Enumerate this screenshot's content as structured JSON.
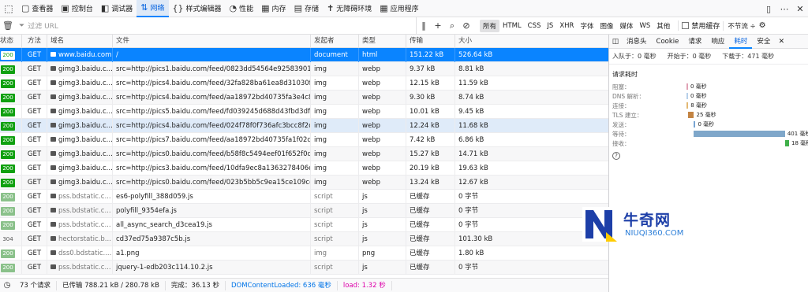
{
  "toolbar": {
    "tabs": [
      {
        "label": "查看器",
        "icon": "inspector-icon",
        "glyph": "▢"
      },
      {
        "label": "控制台",
        "icon": "console-icon",
        "glyph": "▣"
      },
      {
        "label": "调试器",
        "icon": "debugger-icon",
        "glyph": "◧"
      },
      {
        "label": "网络",
        "icon": "network-icon",
        "glyph": "⇅",
        "active": true
      },
      {
        "label": "样式编辑器",
        "icon": "style-editor-icon",
        "glyph": "{}"
      },
      {
        "label": "性能",
        "icon": "performance-icon",
        "glyph": "◔"
      },
      {
        "label": "内存",
        "icon": "memory-icon",
        "glyph": "▦"
      },
      {
        "label": "存储",
        "icon": "storage-icon",
        "glyph": "▤"
      },
      {
        "label": "无障碍环境",
        "icon": "accessibility-icon",
        "glyph": "✝"
      },
      {
        "label": "应用程序",
        "icon": "application-icon",
        "glyph": "▦"
      }
    ]
  },
  "filterbar": {
    "placeholder": "过滤 URL",
    "types": [
      "所有",
      "HTML",
      "CSS",
      "JS",
      "XHR",
      "字体",
      "图像",
      "媒体",
      "WS",
      "其他"
    ],
    "disable_cache": "禁用缓存",
    "throttle": "不节流 ÷"
  },
  "table": {
    "headers": [
      "状态",
      "方法",
      "域名",
      "文件",
      "发起者",
      "类型",
      "传输",
      "大小"
    ],
    "rows": [
      {
        "status": "200",
        "method": "GET",
        "domain": "www.baidu.com",
        "file": "/",
        "initiator": "document",
        "type": "html",
        "transferred": "151.22 kB",
        "size": "526.64 kB",
        "selected": true
      },
      {
        "status": "200",
        "method": "GET",
        "domain": "gimg3.baidu.c...",
        "file": "src=http://pics1.baidu.com/feed/0823dd54564e92583901197b",
        "initiator": "img",
        "type": "webp",
        "transferred": "9.37 kB",
        "size": "8.81 kB"
      },
      {
        "status": "200",
        "method": "GET",
        "domain": "gimg3.baidu.c...",
        "file": "src=http://pics4.baidu.com/feed/32fa828ba61ea8d31030f3e8",
        "initiator": "img",
        "type": "webp",
        "transferred": "12.15 kB",
        "size": "11.59 kB"
      },
      {
        "status": "200",
        "method": "GET",
        "domain": "gimg3.baidu.c...",
        "file": "src=http://pics4.baidu.com/feed/aa18972bd40735fa3e4c8cab",
        "initiator": "img",
        "type": "webp",
        "transferred": "9.30 kB",
        "size": "8.74 kB"
      },
      {
        "status": "200",
        "method": "GET",
        "domain": "gimg3.baidu.c...",
        "file": "src=http://pics5.baidu.com/feed/fd039245d688d43fbd3df0c0",
        "initiator": "img",
        "type": "webp",
        "transferred": "10.01 kB",
        "size": "9.45 kB"
      },
      {
        "status": "200",
        "method": "GET",
        "domain": "gimg3.baidu.c...",
        "file": "src=http://pics4.baidu.com/feed/024f78f0f736afc3bcc8f2da8",
        "initiator": "img",
        "type": "webp",
        "transferred": "12.24 kB",
        "size": "11.68 kB",
        "hover": true
      },
      {
        "status": "200",
        "method": "GET",
        "domain": "gimg3.baidu.c...",
        "file": "src=http://pics7.baidu.com/feed/aa18972bd40735fa1f02d684",
        "initiator": "img",
        "type": "webp",
        "transferred": "7.42 kB",
        "size": "6.86 kB"
      },
      {
        "status": "200",
        "method": "GET",
        "domain": "gimg3.baidu.c...",
        "file": "src=http://pics0.baidu.com/feed/b58f8c5494eef01f652f0dc5e",
        "initiator": "img",
        "type": "webp",
        "transferred": "15.27 kB",
        "size": "14.71 kB"
      },
      {
        "status": "200",
        "method": "GET",
        "domain": "gimg3.baidu.c...",
        "file": "src=http://pics3.baidu.com/feed/10dfa9ec8a1363278406c7bf9",
        "initiator": "img",
        "type": "webp",
        "transferred": "20.19 kB",
        "size": "19.63 kB"
      },
      {
        "status": "200",
        "method": "GET",
        "domain": "gimg3.baidu.c...",
        "file": "src=http://pics0.baidu.com/feed/023b5bb5c9ea15ce109cc8f3b",
        "initiator": "img",
        "type": "webp",
        "transferred": "13.24 kB",
        "size": "12.67 kB"
      },
      {
        "status": "200",
        "method": "GET",
        "domain": "pss.bdstatic.c...",
        "file": "es6-polyfill_388d059.js",
        "initiator": "script",
        "type": "js",
        "transferred": "已缓存",
        "size": "0 字节",
        "cached": true
      },
      {
        "status": "200",
        "method": "GET",
        "domain": "pss.bdstatic.c...",
        "file": "polyfill_9354efa.js",
        "initiator": "script",
        "type": "js",
        "transferred": "已缓存",
        "size": "0 字节",
        "cached": true
      },
      {
        "status": "200",
        "method": "GET",
        "domain": "pss.bdstatic.c...",
        "file": "all_async_search_d3cea19.js",
        "initiator": "script",
        "type": "js",
        "transferred": "已缓存",
        "size": "0 字节",
        "cached": true
      },
      {
        "status": "304",
        "method": "GET",
        "domain": "hectorstatic.b...",
        "file": "cd37ed75a9387c5b.js",
        "initiator": "script",
        "type": "js",
        "transferred": "已缓存",
        "size": "101.30 kB",
        "cached": true,
        "s304": true
      },
      {
        "status": "200",
        "method": "GET",
        "domain": "dss0.bdstatic....",
        "file": "a1.png",
        "initiator": "img",
        "type": "png",
        "transferred": "已缓存",
        "size": "1.80 kB",
        "cached": true
      },
      {
        "status": "200",
        "method": "GET",
        "domain": "pss.bdstatic.c...",
        "file": "jquery-1-edb203c114.10.2.js",
        "initiator": "script",
        "type": "js",
        "transferred": "已缓存",
        "size": "0 字节",
        "cached": true
      }
    ]
  },
  "statusbar": {
    "requests": "73 个请求",
    "transferred": "已传输 788.21 kB / 280.78 kB",
    "finish": "完成：36.13 秒",
    "dcl": "DOMContentLoaded: 636 毫秒",
    "load": "load: 1.32 秒"
  },
  "panel": {
    "tabs": [
      "消息头",
      "Cookie",
      "请求",
      "响应",
      "耗时",
      "安全"
    ],
    "active_tab": "耗时",
    "queued": "入队于：0 毫秒",
    "started": "开始于：0 毫秒",
    "downloaded": "下载于：471 毫秒",
    "section_title": "请求耗时",
    "timings": [
      {
        "label": "阻塞：",
        "value": "0 毫秒",
        "ms": 0,
        "color": "#e1a2b5"
      },
      {
        "label": "DNS 解析：",
        "value": "0 毫秒",
        "ms": 0,
        "color": "#b7d0ea"
      },
      {
        "label": "连接：",
        "value": "8 毫秒",
        "ms": 8,
        "color": "#e2b873"
      },
      {
        "label": "TLS 建立：",
        "value": "25 毫秒",
        "ms": 25,
        "color": "#c38443"
      },
      {
        "label": "发送：",
        "value": "0 毫秒",
        "ms": 0,
        "color": "#78a5d3"
      },
      {
        "label": "等待：",
        "value": "401 毫秒",
        "ms": 401,
        "color": "#7fa7ca"
      },
      {
        "label": "接收：",
        "value": "18 毫秒",
        "ms": 18,
        "color": "#40b04a"
      }
    ]
  },
  "watermark": {
    "cn": "牛奇网",
    "en": "NIUQI360.COM"
  }
}
